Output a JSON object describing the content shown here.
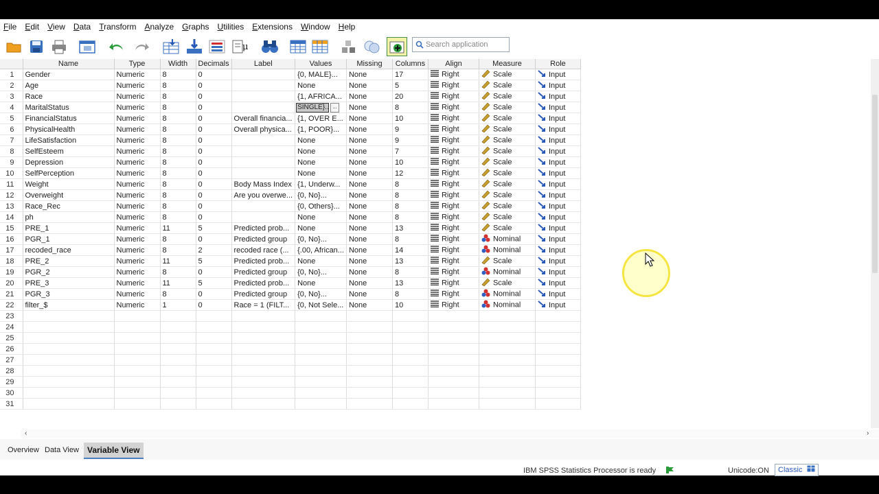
{
  "menu": [
    "File",
    "Edit",
    "View",
    "Data",
    "Transform",
    "Analyze",
    "Graphs",
    "Utilities",
    "Extensions",
    "Window",
    "Help"
  ],
  "search": {
    "placeholder": "Search application"
  },
  "columns": [
    "Name",
    "Type",
    "Width",
    "Decimals",
    "Label",
    "Values",
    "Missing",
    "Columns",
    "Align",
    "Measure",
    "Role"
  ],
  "rows": [
    {
      "num": "1",
      "name": "Gender",
      "type": "Numeric",
      "width": "8",
      "decimals": "0",
      "label": "",
      "values": "{0, MALE}...",
      "missing": "None",
      "columns": "17",
      "align": "Right",
      "measure": "Scale",
      "role": "Input"
    },
    {
      "num": "2",
      "name": "Age",
      "type": "Numeric",
      "width": "8",
      "decimals": "0",
      "label": "",
      "values": "None",
      "missing": "None",
      "columns": "5",
      "align": "Right",
      "measure": "Scale",
      "role": "Input"
    },
    {
      "num": "3",
      "name": "Race",
      "type": "Numeric",
      "width": "8",
      "decimals": "0",
      "label": "",
      "values": "{1, AFRICA...",
      "missing": "None",
      "columns": "20",
      "align": "Right",
      "measure": "Scale",
      "role": "Input"
    },
    {
      "num": "4",
      "name": "MaritalStatus",
      "type": "Numeric",
      "width": "8",
      "decimals": "0",
      "label": "",
      "values": "SINGLE}...",
      "missing": "None",
      "columns": "8",
      "align": "Right",
      "measure": "Scale",
      "role": "Input",
      "selected": true
    },
    {
      "num": "5",
      "name": "FinancialStatus",
      "type": "Numeric",
      "width": "8",
      "decimals": "0",
      "label": "Overall financia...",
      "values": "{1, OVER E...",
      "missing": "None",
      "columns": "10",
      "align": "Right",
      "measure": "Scale",
      "role": "Input"
    },
    {
      "num": "6",
      "name": "PhysicalHealth",
      "type": "Numeric",
      "width": "8",
      "decimals": "0",
      "label": "Overall physica...",
      "values": "{1, POOR}...",
      "missing": "None",
      "columns": "9",
      "align": "Right",
      "measure": "Scale",
      "role": "Input"
    },
    {
      "num": "7",
      "name": "LifeSatisfaction",
      "type": "Numeric",
      "width": "8",
      "decimals": "0",
      "label": "",
      "values": "None",
      "missing": "None",
      "columns": "9",
      "align": "Right",
      "measure": "Scale",
      "role": "Input"
    },
    {
      "num": "8",
      "name": "SelfEsteem",
      "type": "Numeric",
      "width": "8",
      "decimals": "0",
      "label": "",
      "values": "None",
      "missing": "None",
      "columns": "7",
      "align": "Right",
      "measure": "Scale",
      "role": "Input"
    },
    {
      "num": "9",
      "name": "Depression",
      "type": "Numeric",
      "width": "8",
      "decimals": "0",
      "label": "",
      "values": "None",
      "missing": "None",
      "columns": "10",
      "align": "Right",
      "measure": "Scale",
      "role": "Input"
    },
    {
      "num": "10",
      "name": "SelfPerception",
      "type": "Numeric",
      "width": "8",
      "decimals": "0",
      "label": "",
      "values": "None",
      "missing": "None",
      "columns": "12",
      "align": "Right",
      "measure": "Scale",
      "role": "Input"
    },
    {
      "num": "11",
      "name": "Weight",
      "type": "Numeric",
      "width": "8",
      "decimals": "0",
      "label": "Body Mass Index",
      "values": "{1, Underw...",
      "missing": "None",
      "columns": "8",
      "align": "Right",
      "measure": "Scale",
      "role": "Input"
    },
    {
      "num": "12",
      "name": "Overweight",
      "type": "Numeric",
      "width": "8",
      "decimals": "0",
      "label": "Are you overwe...",
      "values": "{0, No}...",
      "missing": "None",
      "columns": "8",
      "align": "Right",
      "measure": "Scale",
      "role": "Input"
    },
    {
      "num": "13",
      "name": "Race_Rec",
      "type": "Numeric",
      "width": "8",
      "decimals": "0",
      "label": "",
      "values": "{0, Others}...",
      "missing": "None",
      "columns": "8",
      "align": "Right",
      "measure": "Scale",
      "role": "Input"
    },
    {
      "num": "14",
      "name": "ph",
      "type": "Numeric",
      "width": "8",
      "decimals": "0",
      "label": "",
      "values": "None",
      "missing": "None",
      "columns": "8",
      "align": "Right",
      "measure": "Scale",
      "role": "Input"
    },
    {
      "num": "15",
      "name": "PRE_1",
      "type": "Numeric",
      "width": "11",
      "decimals": "5",
      "label": "Predicted prob...",
      "values": "None",
      "missing": "None",
      "columns": "13",
      "align": "Right",
      "measure": "Scale",
      "role": "Input"
    },
    {
      "num": "16",
      "name": "PGR_1",
      "type": "Numeric",
      "width": "8",
      "decimals": "0",
      "label": "Predicted group",
      "values": "{0, No}...",
      "missing": "None",
      "columns": "8",
      "align": "Right",
      "measure": "Nominal",
      "role": "Input"
    },
    {
      "num": "17",
      "name": "recoded_race",
      "type": "Numeric",
      "width": "8",
      "decimals": "2",
      "label": "recoded race (...",
      "values": "{.00, African...",
      "missing": "None",
      "columns": "14",
      "align": "Right",
      "measure": "Nominal",
      "role": "Input"
    },
    {
      "num": "18",
      "name": "PRE_2",
      "type": "Numeric",
      "width": "11",
      "decimals": "5",
      "label": "Predicted prob...",
      "values": "None",
      "missing": "None",
      "columns": "13",
      "align": "Right",
      "measure": "Scale",
      "role": "Input"
    },
    {
      "num": "19",
      "name": "PGR_2",
      "type": "Numeric",
      "width": "8",
      "decimals": "0",
      "label": "Predicted group",
      "values": "{0, No}...",
      "missing": "None",
      "columns": "8",
      "align": "Right",
      "measure": "Nominal",
      "role": "Input"
    },
    {
      "num": "20",
      "name": "PRE_3",
      "type": "Numeric",
      "width": "11",
      "decimals": "5",
      "label": "Predicted prob...",
      "values": "None",
      "missing": "None",
      "columns": "13",
      "align": "Right",
      "measure": "Scale",
      "role": "Input"
    },
    {
      "num": "21",
      "name": "PGR_3",
      "type": "Numeric",
      "width": "8",
      "decimals": "0",
      "label": "Predicted group",
      "values": "{0, No}...",
      "missing": "None",
      "columns": "8",
      "align": "Right",
      "measure": "Nominal",
      "role": "Input"
    },
    {
      "num": "22",
      "name": "filter_$",
      "type": "Numeric",
      "width": "1",
      "decimals": "0",
      "label": "Race = 1 (FILT...",
      "values": "{0, Not Sele...",
      "missing": "None",
      "columns": "10",
      "align": "Right",
      "measure": "Nominal",
      "role": "Input"
    }
  ],
  "empty_rows": [
    "23",
    "24",
    "25",
    "26",
    "27",
    "28",
    "29",
    "30",
    "31"
  ],
  "tabs": [
    "Overview",
    "Data View",
    "Variable View"
  ],
  "active_tab": "Variable View",
  "status": {
    "processor": "IBM SPSS Statistics Processor is ready",
    "unicode": "Unicode:ON",
    "classic": "Classic"
  },
  "colors": {
    "scale_icon": "#c8a030",
    "nominal_red": "#d03030",
    "nominal_blue": "#3060c0",
    "input_arrow": "#2a5ab8",
    "accent": "#4a7fc0"
  }
}
